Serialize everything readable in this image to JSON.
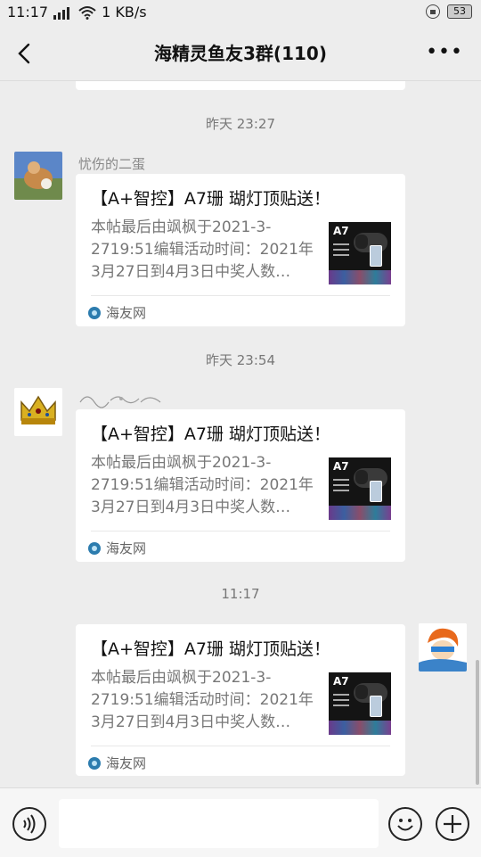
{
  "status_bar": {
    "time": "11:17",
    "network": "3G",
    "speed": "1 KB/s",
    "battery": "53"
  },
  "header": {
    "title": "海精灵鱼友3群(110)"
  },
  "messages": [
    {
      "timestamp": "昨天 23:27",
      "sender": "忧伤的二蛋",
      "card": {
        "title": "【A+智控】A7珊 瑚灯顶贴送！",
        "description": "本帖最后由飒枫于2021-3-2719:51编辑活动时间：2021年3月27日到4月3日中奖人数…",
        "thumbnail_label": "A7",
        "source": "海友网"
      }
    },
    {
      "timestamp": "昨天 23:54",
      "sender": "",
      "card": {
        "title": "【A+智控】A7珊 瑚灯顶贴送！",
        "description": "本帖最后由飒枫于2021-3-2719:51编辑活动时间：2021年3月27日到4月3日中奖人数…",
        "thumbnail_label": "A7",
        "source": "海友网"
      }
    },
    {
      "timestamp": "11:17",
      "sender": "",
      "card": {
        "title": "【A+智控】A7珊 瑚灯顶贴送！",
        "description": "本帖最后由飒枫于2021-3-2719:51编辑活动时间：2021年3月27日到4月3日中奖人数…",
        "thumbnail_label": "A7",
        "source": "海友网"
      }
    }
  ],
  "input_bar": {
    "placeholder": ""
  },
  "icons": {
    "back": "chevron-left-icon",
    "more": "more-dots-icon",
    "voice": "voice-icon",
    "emoji": "emoji-icon",
    "plus": "plus-icon"
  }
}
